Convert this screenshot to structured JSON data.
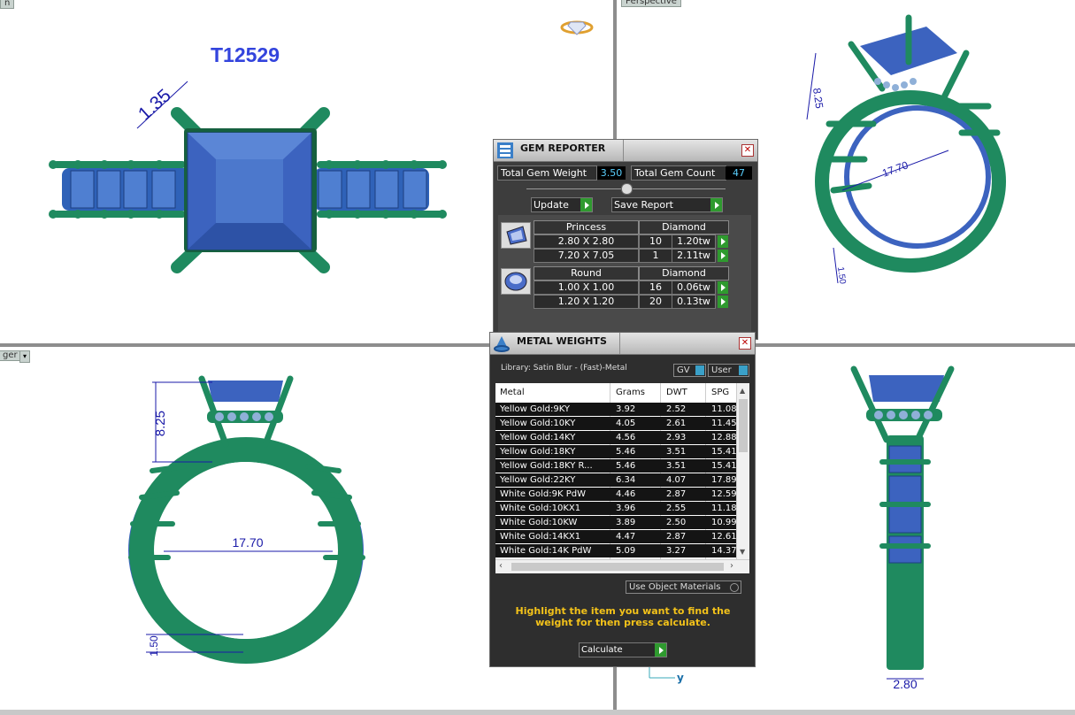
{
  "viewports": {
    "top_left": {
      "title": "T12529",
      "dim_width": "1.35"
    },
    "top_right": {
      "tab": "Perspective",
      "dim_height": "8.25",
      "dim_diameter": "17.70",
      "dim_band": "1.50"
    },
    "bottom_left": {
      "tab": "ger",
      "dim_height": "8.25",
      "dim_diameter": "17.70",
      "dim_band": "1.50"
    },
    "bottom_right": {
      "dim_band": "2.80",
      "axis_label": "y"
    },
    "top_left_tab": "n"
  },
  "gem_reporter": {
    "title": "GEM REPORTER",
    "total_weight_label": "Total Gem Weight",
    "total_weight": "3.50",
    "total_count_label": "Total Gem Count",
    "total_count": "47",
    "update_label": "Update",
    "save_label": "Save Report",
    "groups": [
      {
        "shape": "Princess",
        "material": "Diamond",
        "rows": [
          {
            "size": "2.80 X 2.80",
            "count": "10",
            "weight": "1.20tw"
          },
          {
            "size": "7.20 X 7.05",
            "count": "1",
            "weight": "2.11tw"
          }
        ]
      },
      {
        "shape": "Round",
        "material": "Diamond",
        "rows": [
          {
            "size": "1.00 X 1.00",
            "count": "16",
            "weight": "0.06tw"
          },
          {
            "size": "1.20 X 1.20",
            "count": "20",
            "weight": "0.13tw"
          }
        ]
      }
    ]
  },
  "metal_weights": {
    "title": "METAL WEIGHTS",
    "library": "Library: Satin Blur - (Fast)-Metal",
    "gv_label": "GV",
    "user_label": "User",
    "columns": [
      "Metal",
      "Grams",
      "DWT",
      "SPG"
    ],
    "rows": [
      [
        "Yellow Gold:9KY",
        "3.92",
        "2.52",
        "11.08"
      ],
      [
        "Yellow Gold:10KY",
        "4.05",
        "2.61",
        "11.45"
      ],
      [
        "Yellow Gold:14KY",
        "4.56",
        "2.93",
        "12.88"
      ],
      [
        "Yellow Gold:18KY",
        "5.46",
        "3.51",
        "15.41"
      ],
      [
        "Yellow Gold:18KY R...",
        "5.46",
        "3.51",
        "15.41"
      ],
      [
        "Yellow Gold:22KY",
        "6.34",
        "4.07",
        "17.89"
      ],
      [
        "White Gold:9K PdW",
        "4.46",
        "2.87",
        "12.59"
      ],
      [
        "White Gold:10KX1",
        "3.96",
        "2.55",
        "11.18"
      ],
      [
        "White Gold:10KW",
        "3.89",
        "2.50",
        "10.99"
      ],
      [
        "White Gold:14KX1",
        "4.47",
        "2.87",
        "12.61"
      ],
      [
        "White Gold:14K PdW",
        "5.09",
        "3.27",
        "14.37"
      ]
    ],
    "use_object_materials": "Use Object Materials",
    "hint": "Highlight the item you want to find the weight for then press calculate.",
    "calculate_label": "Calculate"
  },
  "colors": {
    "metal": "#1f8a5f",
    "gem": "#3c63bf",
    "dimension": "#1a1aa8",
    "title": "#3344dd",
    "panel_bg": "#3d3d3d",
    "hint": "#f3c21a"
  }
}
